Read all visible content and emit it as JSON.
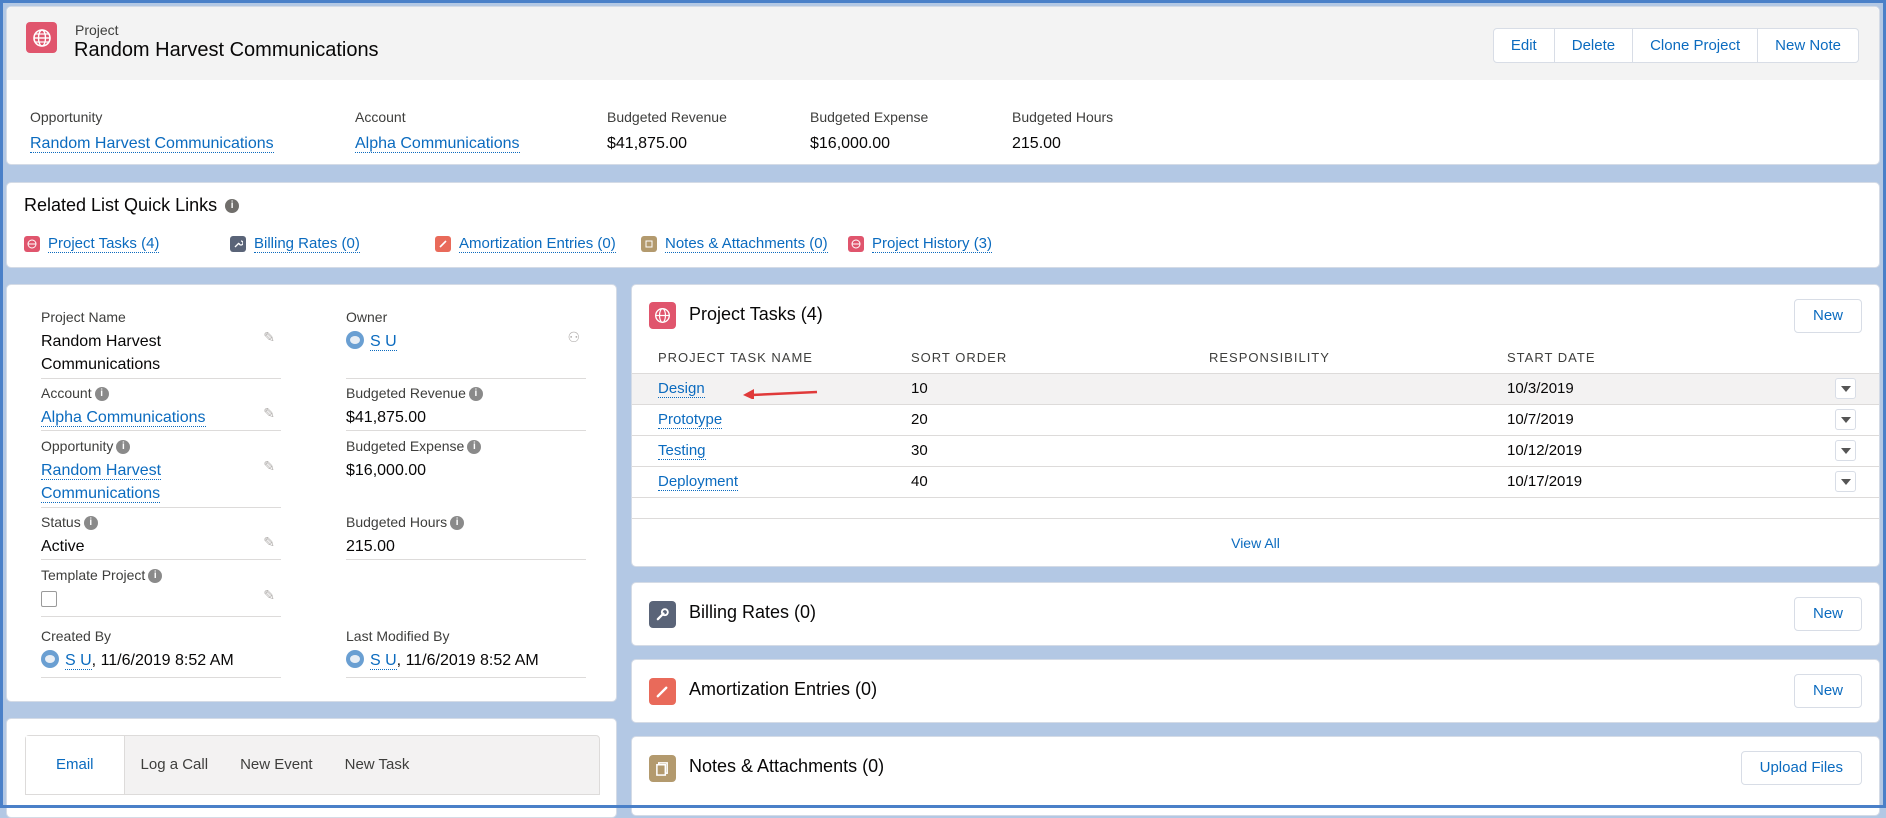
{
  "header": {
    "object_label": "Project",
    "title": "Random Harvest Communications",
    "buttons": [
      "Edit",
      "Delete",
      "Clone Project",
      "New Note"
    ],
    "highlights": [
      {
        "label": "Opportunity",
        "value": "Random Harvest Communications",
        "link": true
      },
      {
        "label": "Account",
        "value": "Alpha Communications",
        "link": true
      },
      {
        "label": "Budgeted Revenue",
        "value": "$41,875.00",
        "link": false
      },
      {
        "label": "Budgeted Expense",
        "value": "$16,000.00",
        "link": false
      },
      {
        "label": "Budgeted Hours",
        "value": "215.00",
        "link": false
      }
    ]
  },
  "quick_links": {
    "title": "Related List Quick Links",
    "items": [
      {
        "label": "Project Tasks (4)",
        "icon": "globe-icon",
        "color": "#e0556d"
      },
      {
        "label": "Billing Rates (0)",
        "icon": "wrench-icon",
        "color": "#5a6478"
      },
      {
        "label": "Amortization Entries (0)",
        "icon": "pencil-icon",
        "color": "#e96a5a"
      },
      {
        "label": "Notes & Attachments (0)",
        "icon": "note-icon",
        "color": "#b39a6e"
      },
      {
        "label": "Project History (3)",
        "icon": "globe-icon",
        "color": "#e0556d"
      }
    ]
  },
  "details": {
    "project_name_label": "Project Name",
    "project_name_line1": "Random Harvest",
    "project_name_line2": "Communications",
    "owner_label": "Owner",
    "owner_value": "S U",
    "account_label": "Account",
    "account_value": "Alpha Communications",
    "budgeted_revenue_label": "Budgeted Revenue",
    "budgeted_revenue_value": "$41,875.00",
    "opportunity_label": "Opportunity",
    "opportunity_line1": "Random Harvest",
    "opportunity_line2": "Communications",
    "budgeted_expense_label": "Budgeted Expense",
    "budgeted_expense_value": "$16,000.00",
    "status_label": "Status",
    "status_value": "Active",
    "budgeted_hours_label": "Budgeted Hours",
    "budgeted_hours_value": "215.00",
    "template_label": "Template Project",
    "template_checked": false,
    "created_by_label": "Created By",
    "created_by_user": "S U",
    "created_by_date": ", 11/6/2019 8:52 AM",
    "modified_by_label": "Last Modified By",
    "modified_by_user": "S U",
    "modified_by_date": ", 11/6/2019 8:52 AM"
  },
  "activity": {
    "tabs": [
      "Email",
      "Log a Call",
      "New Event",
      "New Task"
    ]
  },
  "project_tasks": {
    "title": "Project Tasks (4)",
    "new_label": "New",
    "columns": [
      "PROJECT TASK NAME",
      "SORT ORDER",
      "RESPONSIBILITY",
      "START DATE"
    ],
    "rows": [
      {
        "name": "Design",
        "sort": "10",
        "resp": "",
        "start": "10/3/2019"
      },
      {
        "name": "Prototype",
        "sort": "20",
        "resp": "",
        "start": "10/7/2019"
      },
      {
        "name": "Testing",
        "sort": "30",
        "resp": "",
        "start": "10/12/2019"
      },
      {
        "name": "Deployment",
        "sort": "40",
        "resp": "",
        "start": "10/17/2019"
      }
    ],
    "view_all": "View All"
  },
  "billing_rates": {
    "title": "Billing Rates (0)",
    "button": "New"
  },
  "amortization": {
    "title": "Amortization Entries (0)",
    "button": "New"
  },
  "notes": {
    "title": "Notes & Attachments (0)",
    "button": "Upload Files"
  },
  "colors": {
    "link": "#0b6bbf",
    "project_icon": "#e0556d",
    "billing_icon": "#5a6478",
    "amort_icon": "#e96a5a",
    "notes_icon": "#b39a6e",
    "arrow": "#e03a3a"
  }
}
